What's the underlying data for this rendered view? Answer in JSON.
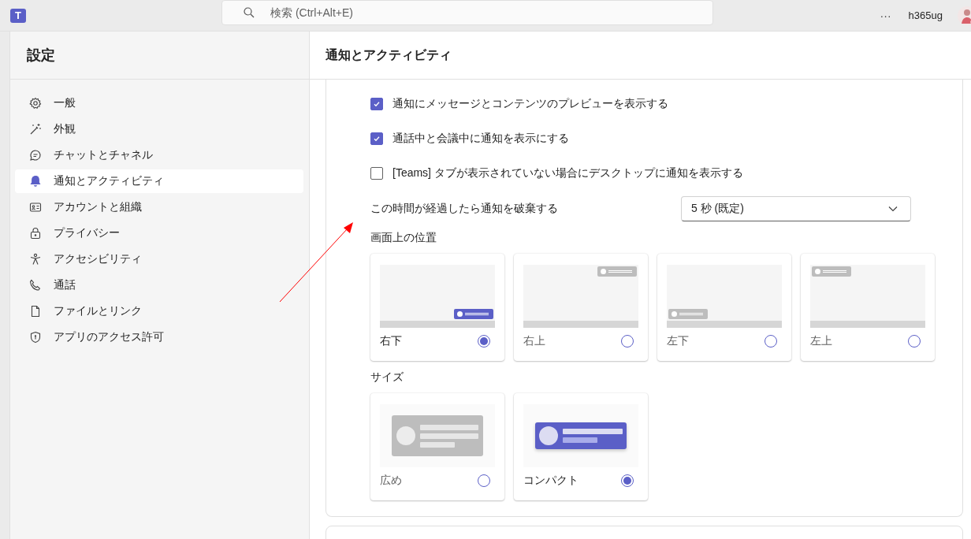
{
  "app_bar": {
    "logo_text": "T",
    "search": {
      "placeholder": "検索 (Ctrl+Alt+E)"
    },
    "more": "···",
    "user": "h365ug"
  },
  "sidebar": {
    "title": "設定",
    "items": [
      {
        "label": "一般",
        "kind": "gear",
        "selected": false
      },
      {
        "label": "外観",
        "kind": "wand",
        "selected": false
      },
      {
        "label": "チャットとチャネル",
        "kind": "chat",
        "selected": false
      },
      {
        "label": "通知とアクティビティ",
        "kind": "bell",
        "selected": true
      },
      {
        "label": "アカウントと組織",
        "kind": "card",
        "selected": false
      },
      {
        "label": "プライバシー",
        "kind": "lock",
        "selected": false
      },
      {
        "label": "アクセシビリティ",
        "kind": "person",
        "selected": false
      },
      {
        "label": "通話",
        "kind": "phone",
        "selected": false
      },
      {
        "label": "ファイルとリンク",
        "kind": "file",
        "selected": false
      },
      {
        "label": "アプリのアクセス許可",
        "kind": "shield",
        "selected": false
      }
    ]
  },
  "main": {
    "title": "通知とアクティビティ",
    "checkboxes": [
      {
        "label": "通知にメッセージとコンテンツのプレビューを表示する",
        "checked": true
      },
      {
        "label": "通話中と会議中に通知を表示にする",
        "checked": true
      },
      {
        "label": "[Teams] タブが表示されていない場合にデスクトップに通知を表示する",
        "checked": false
      }
    ],
    "dismiss": {
      "label": "この時間が経過したら通知を破棄する",
      "value": "5 秒 (既定)"
    },
    "position": {
      "label": "画面上の位置",
      "options": [
        {
          "label": "右下",
          "kind": "bottom-right",
          "selected": true
        },
        {
          "label": "右上",
          "kind": "top-right",
          "selected": false
        },
        {
          "label": "左下",
          "kind": "bottom-left",
          "selected": false
        },
        {
          "label": "左上",
          "kind": "top-left",
          "selected": false
        }
      ]
    },
    "size": {
      "label": "サイズ",
      "options": [
        {
          "label": "広め",
          "kind": "wide",
          "selected": false
        },
        {
          "label": "コンパクト",
          "kind": "compact",
          "selected": true
        }
      ]
    }
  }
}
